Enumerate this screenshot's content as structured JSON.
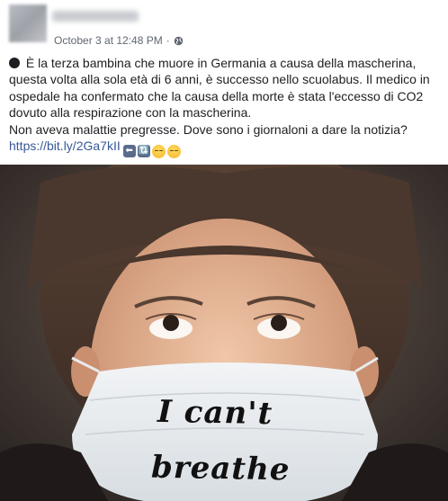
{
  "post": {
    "timestamp": "October 3 at 12:48 PM",
    "separator": "·",
    "privacy_icon": "globe-icon",
    "line1": "È la terza bambina che muore in Germania a causa della mascherina, questa volta alla sola età di 6 anni, è successo nello scuolabus. Il medico in ospedale ha confermato che la causa della morte è stata l'eccesso di CO2 dovuto alla respirazione con la mascherina.",
    "line2": "Non aveva malattie pregresse. Dove sono i giornaloni a dare la notizia?",
    "link": "https://bit.ly/2Ga7kII",
    "emojis": [
      "back-arrow-icon",
      "arrows-clockwise-icon",
      "pensive-face-icon",
      "sad-face-icon"
    ],
    "icon_back": "⬅",
    "icon_refresh": "🔃"
  },
  "photo": {
    "mask_text_line1": "I can't",
    "mask_text_line2": "breathe"
  },
  "colors": {
    "link": "#385898",
    "meta": "#606770",
    "text": "#1c1e21"
  }
}
